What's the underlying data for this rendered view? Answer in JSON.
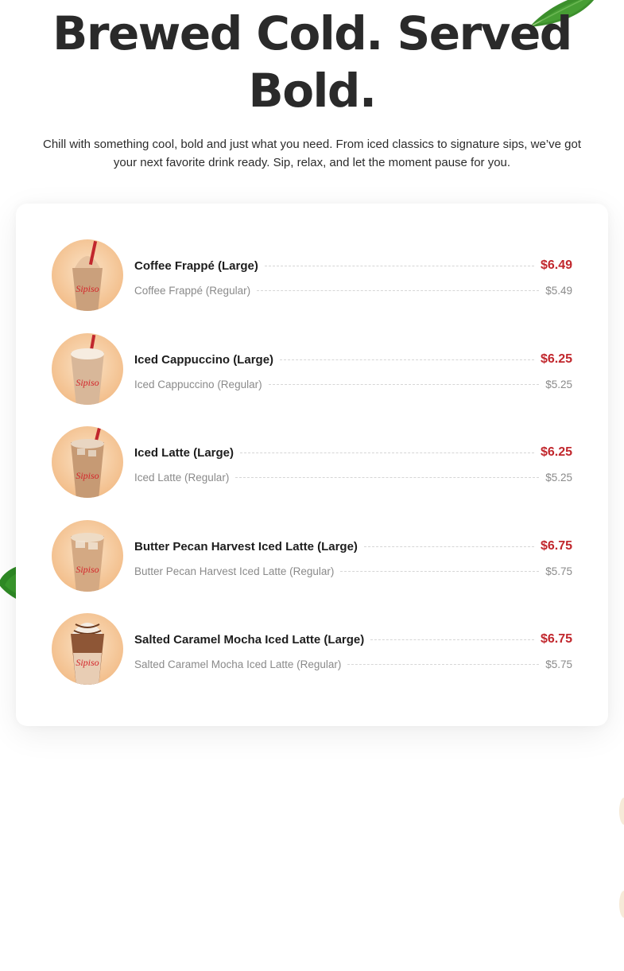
{
  "hero": {
    "title": "Brewed Cold. Served Bold.",
    "subtitle": "Chill with something cool, bold and just what you need. From iced classics to signature sips, we’ve got your next favorite drink ready. Sip, relax, and let the moment pause for you."
  },
  "colors": {
    "accent_price": "#c1272d",
    "title": "#2a2a2a",
    "muted": "#8a8a8a",
    "cup_orange": "#f3c08e"
  },
  "menu": {
    "items": [
      {
        "name_large": "Coffee Frappé (Large)",
        "price_large": "$6.49",
        "name_regular": "Coffee Frappé (Regular)",
        "price_regular": "$5.49",
        "image": "coffee-frappe-cup"
      },
      {
        "name_large": "Iced Cappuccino (Large)",
        "price_large": "$6.25",
        "name_regular": "Iced Cappuccino (Regular)",
        "price_regular": "$5.25",
        "image": "iced-cappuccino-cup"
      },
      {
        "name_large": "Iced Latte (Large)",
        "price_large": "$6.25",
        "name_regular": "Iced Latte (Regular)",
        "price_regular": "$5.25",
        "image": "iced-latte-cup"
      },
      {
        "name_large": "Butter Pecan Harvest Iced Latte (Large)",
        "price_large": "$6.75",
        "name_regular": "Butter Pecan Harvest Iced Latte (Regular)",
        "price_regular": "$5.75",
        "image": "butter-pecan-iced-latte-cup"
      },
      {
        "name_large": "Salted Caramel Mocha Iced Latte (Large)",
        "price_large": "$6.75",
        "name_regular": "Salted Caramel Mocha Iced Latte (Regular)",
        "price_regular": "$5.75",
        "image": "salted-caramel-mocha-cup"
      }
    ]
  }
}
